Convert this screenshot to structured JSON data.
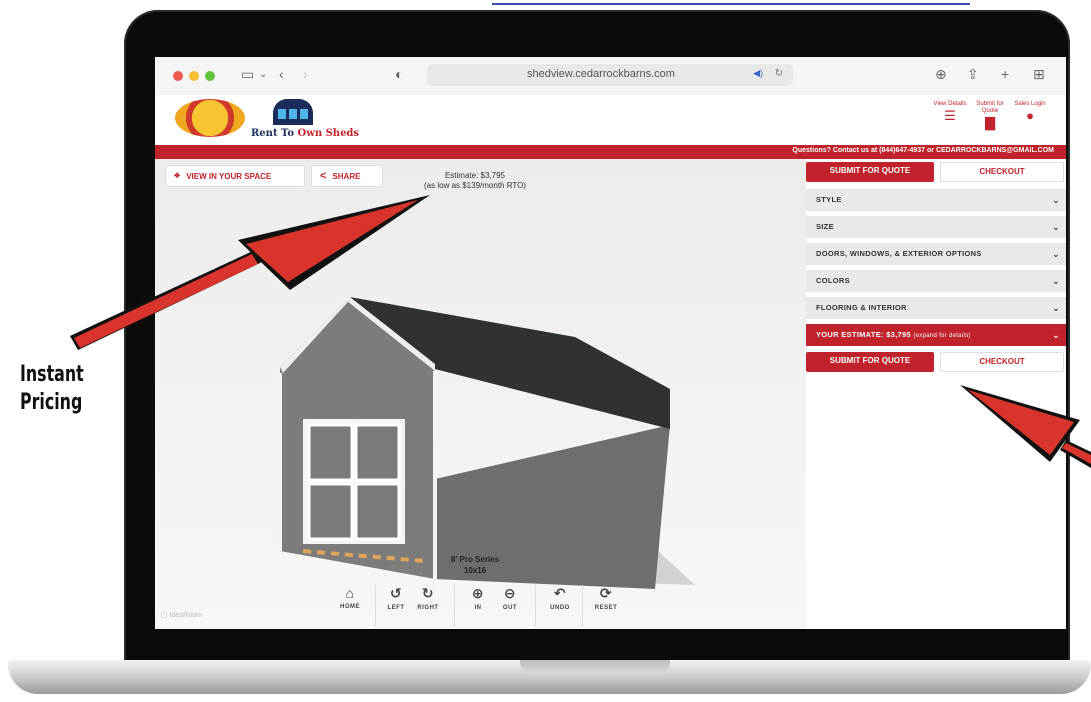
{
  "browser": {
    "url": "shedview.cedarrockbarns.com"
  },
  "header": {
    "logo_text": "Rent To Own Sheds",
    "logo_text_a": "Rent To ",
    "logo_text_b": "Own Sheds",
    "links": [
      {
        "label": "View Details",
        "icon": "list-icon"
      },
      {
        "label": "Submit for Quote",
        "icon": "document-icon"
      },
      {
        "label": "Sales Login",
        "icon": "user-icon"
      }
    ],
    "contact": "Questions? Contact us at (844)647-4937 or CEDARROCKBARNS@GMAIL.COM"
  },
  "viewer": {
    "view_in_space": "VIEW IN YOUR SPACE",
    "share": "SHARE",
    "estimate_line1": "Estimate: $3,795",
    "estimate_line2": "(as low as $139/month RTO)",
    "model_name": "8' Pro Series",
    "model_size": "10x16",
    "watermark": "IdeaRoom",
    "tools": [
      {
        "label": "HOME",
        "icon": "home-icon"
      },
      {
        "label": "LEFT",
        "icon": "rotate-left-icon"
      },
      {
        "label": "RIGHT",
        "icon": "rotate-right-icon"
      },
      {
        "label": "IN",
        "icon": "zoom-in-icon"
      },
      {
        "label": "OUT",
        "icon": "zoom-out-icon"
      },
      {
        "label": "UNDO",
        "icon": "undo-icon"
      },
      {
        "label": "RESET",
        "icon": "reset-icon"
      }
    ]
  },
  "panel": {
    "submit_quote": "SUBMIT FOR QUOTE",
    "checkout": "CHECKOUT",
    "sections": [
      "STYLE",
      "SIZE",
      "DOORS, WINDOWS, & EXTERIOR OPTIONS",
      "COLORS",
      "FLOORING & INTERIOR"
    ],
    "estimate_label": "YOUR ESTIMATE: $3,795",
    "estimate_small": "(expand for details)"
  },
  "annotation": {
    "line1": "Instant",
    "line2": "Pricing"
  },
  "colors": {
    "brand_red": "#c0232b",
    "accordion_bg": "#e9e9e9"
  }
}
